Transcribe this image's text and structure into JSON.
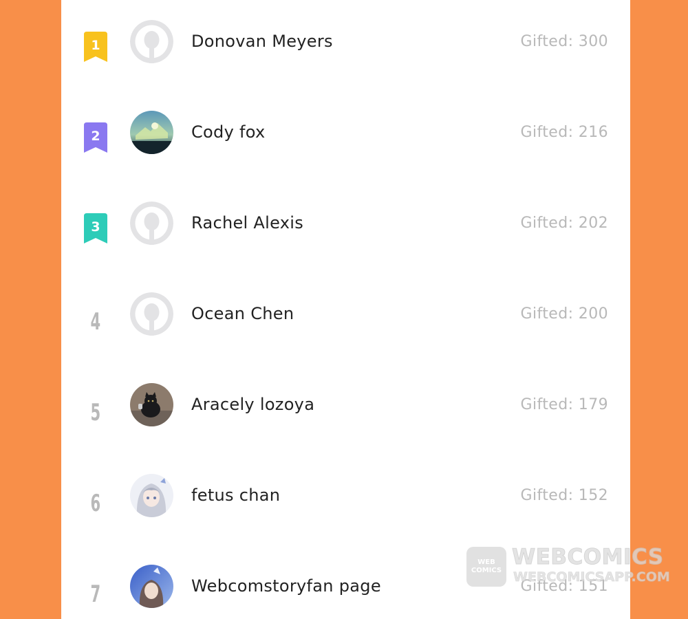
{
  "leaderboard": {
    "gifted_prefix": "Gifted: ",
    "entries": [
      {
        "rank": "1",
        "name": "Donovan Meyers",
        "gifted": "Gifted: 300",
        "avatar": "default-avatar-icon",
        "badge_color": "#F8C21E"
      },
      {
        "rank": "2",
        "name": "Cody fox",
        "gifted": "Gifted: 216",
        "avatar": "user-photo",
        "badge_color": "#8A78F0"
      },
      {
        "rank": "3",
        "name": "Rachel Alexis",
        "gifted": "Gifted: 202",
        "avatar": "default-avatar-icon",
        "badge_color": "#2DCCB8"
      },
      {
        "rank": "4",
        "name": "Ocean Chen",
        "gifted": "Gifted: 200",
        "avatar": "default-avatar-icon"
      },
      {
        "rank": "5",
        "name": "Aracely lozoya",
        "gifted": "Gifted: 179",
        "avatar": "user-photo"
      },
      {
        "rank": "6",
        "name": "fetus chan",
        "gifted": "Gifted: 152",
        "avatar": "user-photo"
      },
      {
        "rank": "7",
        "name": "Webcomstoryfan page",
        "gifted": "Gifted: 151",
        "avatar": "user-photo"
      }
    ]
  },
  "watermark": {
    "badge_line1": "WEB",
    "badge_line2": "COMICS",
    "title": "WEBCOMICS",
    "subtitle": "WEBCOMICSAPP.COM"
  },
  "colors": {
    "background": "#F88F49",
    "panel": "#FFFFFF",
    "name_text": "#222222",
    "gifted_text": "#B8B8B8",
    "rank_text": "#B9B9B9"
  }
}
